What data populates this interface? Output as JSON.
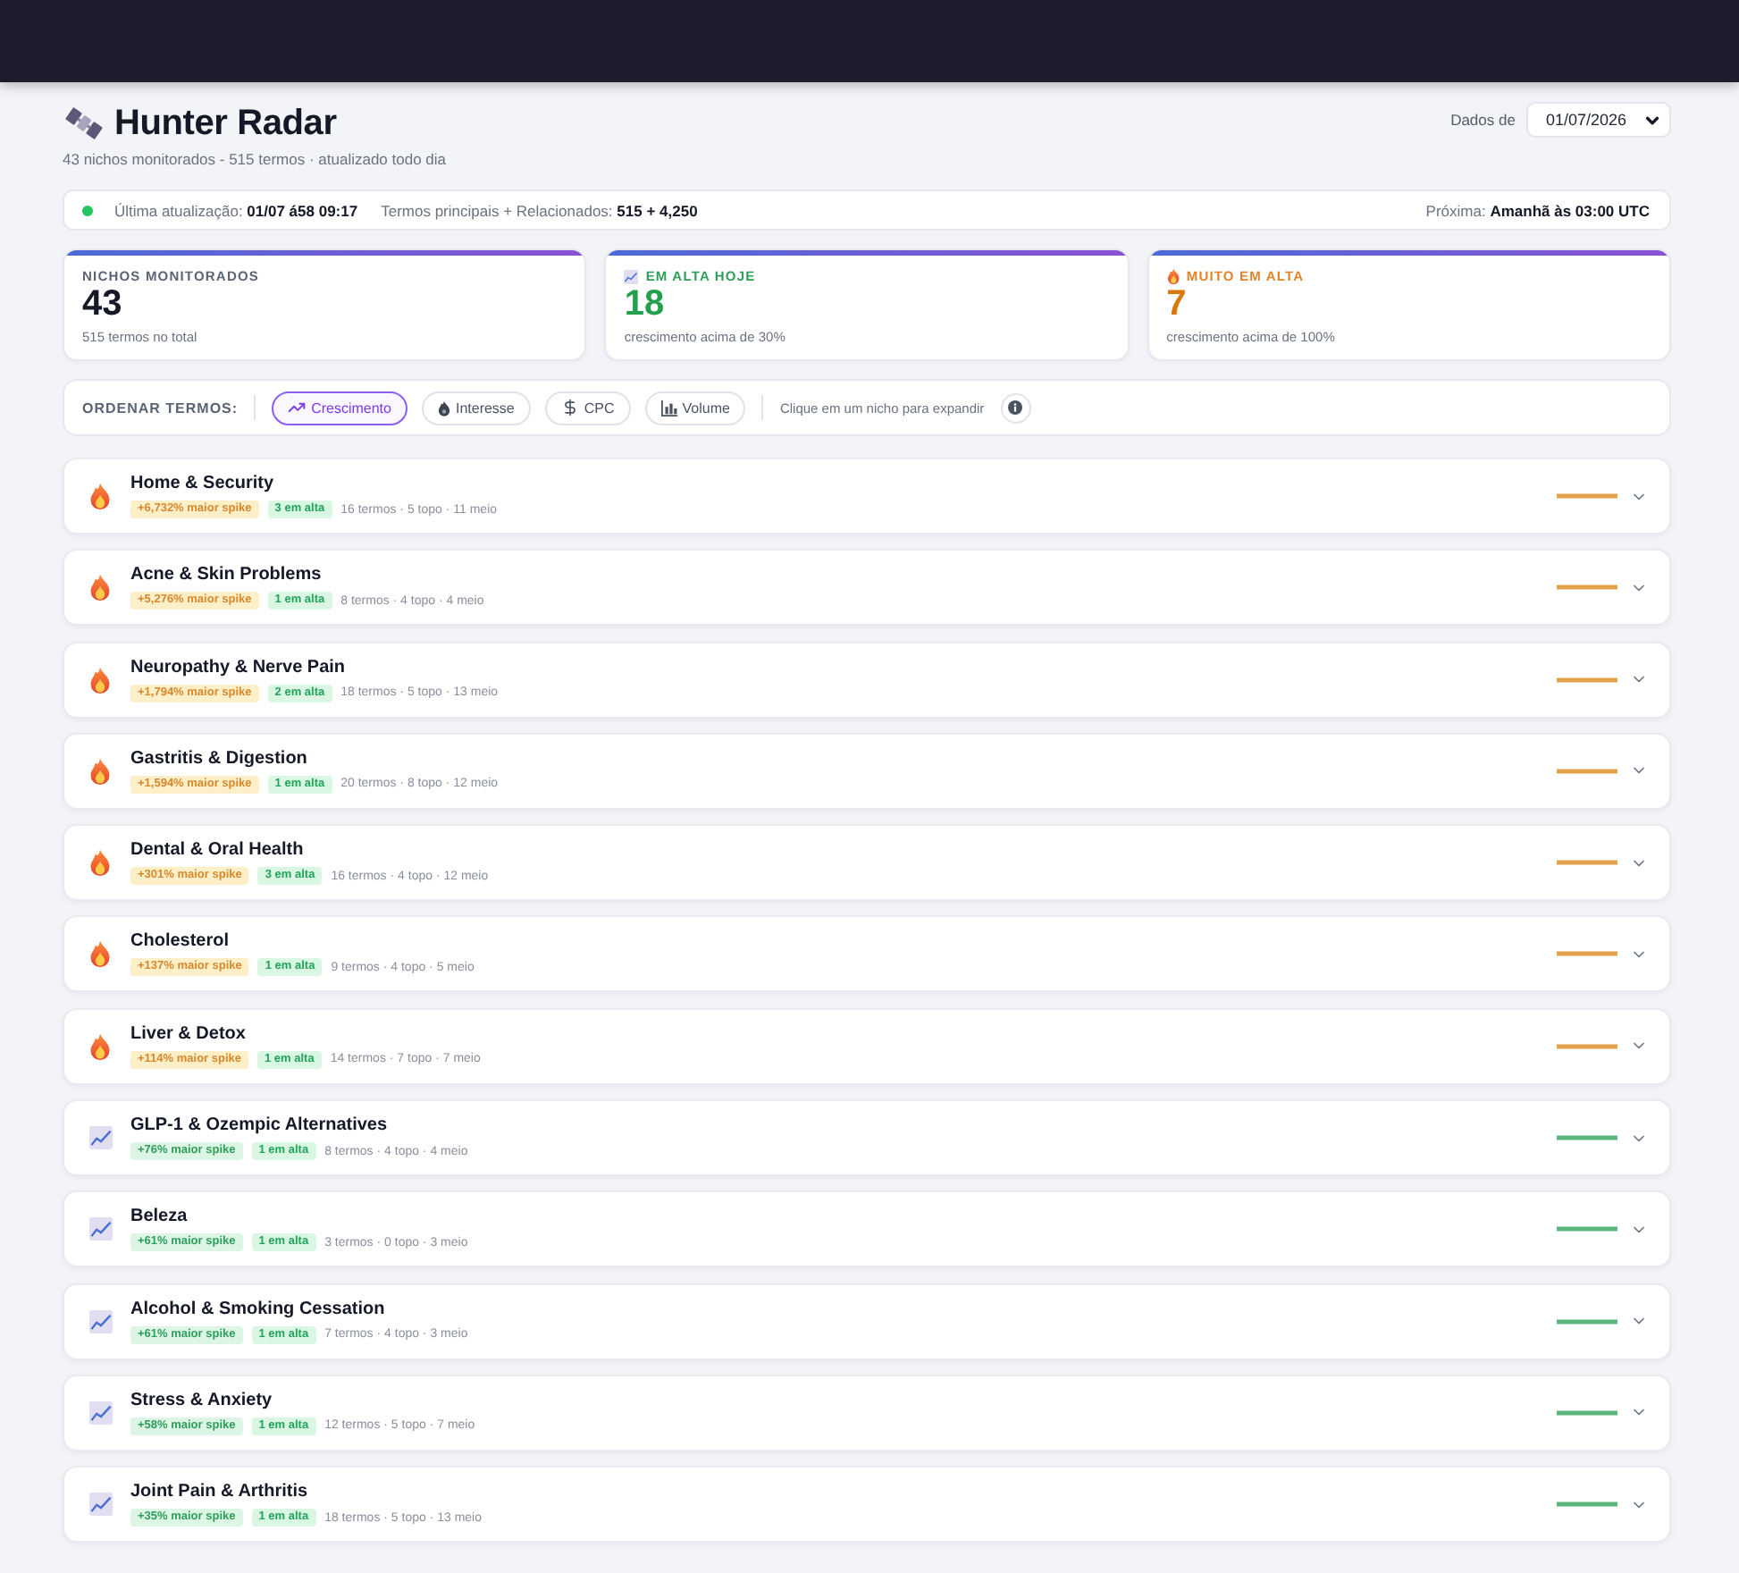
{
  "header": {
    "title": "Hunter Radar",
    "subtitle": "43 nichos monitorados - 515 termos · atualizado todo dia",
    "date_label": "Dados de",
    "date_value": "01/07/2026"
  },
  "status_bar": {
    "last_update": "Última atualização: **01/07 á58 09:17**",
    "terms": "Termos principais + Relacionados: **515 + 4,250**",
    "next": "Próxima: **Amanhã às 03:00 UTC**"
  },
  "stats": [
    {
      "kind": "total",
      "label": "NICHOS MONITORADOS",
      "value": "43",
      "note": "515 termos no total"
    },
    {
      "kind": "trending",
      "label": "EM ALTA HOJE",
      "value": "18",
      "note": "crescimento acima de 30%"
    },
    {
      "kind": "fire",
      "label": "MUITO EM ALTA",
      "value": "7",
      "note": "crescimento acima de 100%"
    }
  ],
  "sort": {
    "label": "ORDENAR TERMOS:",
    "options": [
      {
        "kind": "growth",
        "label": "Crescimento",
        "selected": true
      },
      {
        "kind": "interest",
        "label": "Interesse",
        "selected": false
      },
      {
        "kind": "cpc",
        "label": "CPC",
        "selected": false
      },
      {
        "kind": "volume",
        "label": "Volume",
        "selected": false
      }
    ],
    "hint": "Clique em um nicho para expandir"
  },
  "niches": [
    {
      "kind": "fire",
      "name": "Home & Security",
      "spike": "+6,732% maior spike",
      "rising": "3 em alta",
      "meta": "16 termos · 5 topo · 11 meio",
      "expanded": false
    },
    {
      "kind": "fire",
      "name": "Acne & Skin Problems",
      "spike": "+5,276% maior spike",
      "rising": "1 em alta",
      "meta": "8 termos · 4 topo · 4 meio",
      "expanded": false
    },
    {
      "kind": "fire",
      "name": "Neuropathy & Nerve Pain",
      "spike": "+1,794% maior spike",
      "rising": "2 em alta",
      "meta": "18 termos · 5 topo · 13 meio",
      "expanded": false
    },
    {
      "kind": "fire",
      "name": "Gastritis & Digestion",
      "spike": "+1,594% maior spike",
      "rising": "1 em alta",
      "meta": "20 termos · 8 topo · 12 meio",
      "expanded": false
    },
    {
      "kind": "fire",
      "name": "Dental & Oral Health",
      "spike": "+301% maior spike",
      "rising": "3 em alta",
      "meta": "16 termos · 4 topo · 12 meio",
      "expanded": false
    },
    {
      "kind": "fire",
      "name": "Cholesterol",
      "spike": "+137% maior spike",
      "rising": "1 em alta",
      "meta": "9 termos · 4 topo · 5 meio",
      "expanded": false
    },
    {
      "kind": "fire",
      "name": "Liver & Detox",
      "spike": "+114% maior spike",
      "rising": "1 em alta",
      "meta": "14 termos · 7 topo · 7 meio",
      "expanded": false
    },
    {
      "kind": "trending",
      "name": "GLP-1 & Ozempic Alternatives",
      "spike": "+76% maior spike",
      "rising": "1 em alta",
      "meta": "8 termos · 4 topo · 4 meio",
      "expanded": false
    },
    {
      "kind": "trending",
      "name": "Beleza",
      "spike": "+61% maior spike",
      "rising": "1 em alta",
      "meta": "3 termos · 0 topo · 3 meio",
      "expanded": false
    },
    {
      "kind": "trending",
      "name": "Alcohol & Smoking Cessation",
      "spike": "+61% maior spike",
      "rising": "1 em alta",
      "meta": "7 termos · 4 topo · 3 meio",
      "expanded": false
    },
    {
      "kind": "trending",
      "name": "Stress & Anxiety",
      "spike": "+58% maior spike",
      "rising": "1 em alta",
      "meta": "12 termos · 5 topo · 7 meio",
      "expanded": false
    },
    {
      "kind": "trending",
      "name": "Joint Pain & Arthritis",
      "spike": "+35% maior spike",
      "rising": "1 em alta",
      "meta": "18 termos · 5 topo · 13 meio",
      "expanded": false
    }
  ]
}
